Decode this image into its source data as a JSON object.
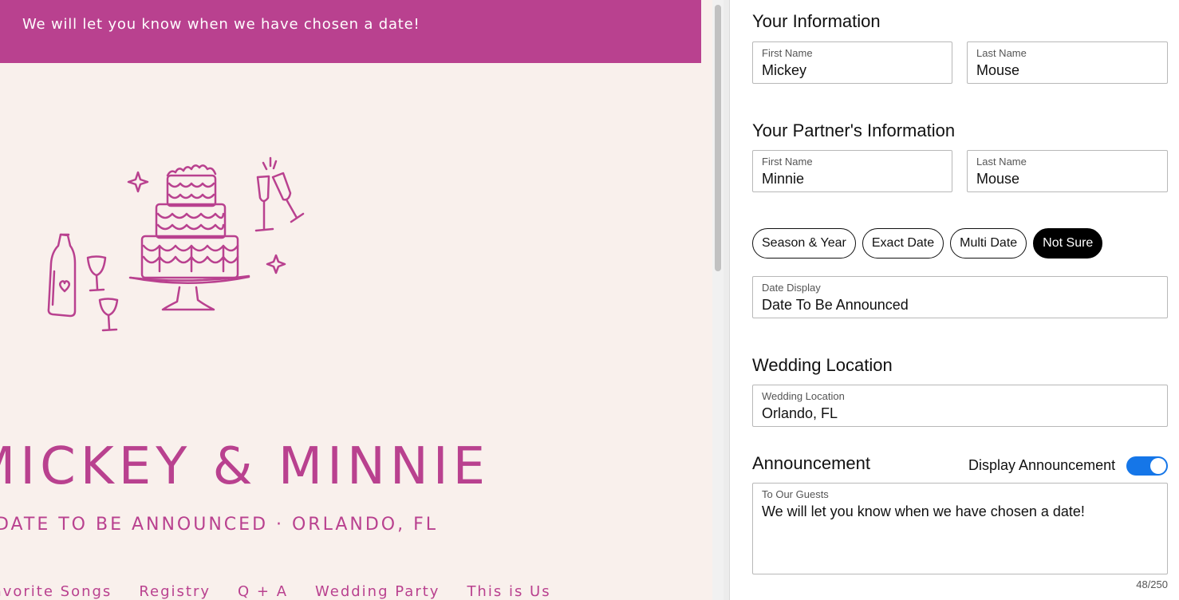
{
  "preview": {
    "banner_text": "We will let you know when we have chosen a date!",
    "couple_names": "MICKEY & MINNIE",
    "date_location": "DATE TO BE ANNOUNCED · ORLANDO, FL",
    "nav": [
      "Favorite Songs",
      "Registry",
      "Q + A",
      "Wedding Party",
      "This is Us"
    ],
    "accent_color": "#b9418f",
    "background_color": "#f9f0ec"
  },
  "your_info": {
    "title": "Your Information",
    "first_name": {
      "label": "First Name",
      "value": "Mickey"
    },
    "last_name": {
      "label": "Last Name",
      "value": "Mouse"
    }
  },
  "partner_info": {
    "title": "Your Partner's Information",
    "first_name": {
      "label": "First Name",
      "value": "Minnie"
    },
    "last_name": {
      "label": "Last Name",
      "value": "Mouse"
    }
  },
  "date_options": {
    "chips": [
      "Season & Year",
      "Exact Date",
      "Multi Date",
      "Not Sure"
    ],
    "selected": "Not Sure"
  },
  "date_display": {
    "label": "Date Display",
    "value": "Date To Be Announced"
  },
  "location": {
    "title": "Wedding Location",
    "label": "Wedding Location",
    "value": "Orlando, FL"
  },
  "announcement": {
    "title": "Announcement",
    "toggle_label": "Display Announcement",
    "toggle_on": true,
    "label": "To Our Guests",
    "value": "We will let you know when we have chosen a date!",
    "counter": "48/250",
    "toggle_color": "#1576e8"
  }
}
